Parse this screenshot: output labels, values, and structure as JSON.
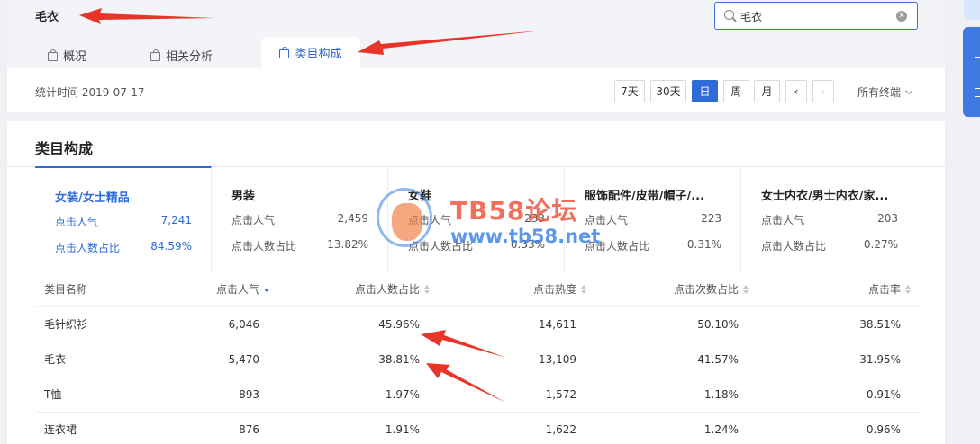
{
  "header": {
    "title": "毛衣",
    "search": {
      "value": "毛衣",
      "placeholder": ""
    },
    "tabs": [
      {
        "label": "概况"
      },
      {
        "label": "相关分析"
      },
      {
        "label": "类目构成",
        "active": true
      }
    ]
  },
  "toolbar": {
    "stat_date_label": "统计时间 2019-07-17",
    "ranges": [
      "7天",
      "30天",
      "日",
      "周",
      "月"
    ],
    "active_range": "日",
    "prev_icon": "‹",
    "next_icon": "›",
    "terminal": "所有终端"
  },
  "category": {
    "title": "类目构成",
    "cards": [
      {
        "name": "女装/女士精品",
        "metric1_label": "点击人气",
        "metric1_value": "7,241",
        "metric2_label": "点击人数占比",
        "metric2_value": "84.59%"
      },
      {
        "name": "男装",
        "metric1_label": "点击人气",
        "metric1_value": "2,459",
        "metric2_label": "点击人数占比",
        "metric2_value": "13.82%"
      },
      {
        "name": "女鞋",
        "metric1_label": "点击人气",
        "metric1_value": "233",
        "metric2_label": "点击人数占比",
        "metric2_value": "0.33%"
      },
      {
        "name": "服饰配件/皮带/帽子/...",
        "metric1_label": "点击人气",
        "metric1_value": "223",
        "metric2_label": "点击人数占比",
        "metric2_value": "0.31%"
      },
      {
        "name": "女士内衣/男士内衣/家...",
        "metric1_label": "点击人气",
        "metric1_value": "203",
        "metric2_label": "点击人数占比",
        "metric2_value": "0.27%"
      }
    ],
    "table": {
      "columns": [
        "类目名称",
        "点击人气",
        "点击人数占比",
        "点击热度",
        "点击次数占比",
        "点击率"
      ],
      "rows": [
        [
          "毛针织衫",
          "6,046",
          "45.96%",
          "14,611",
          "50.10%",
          "38.51%"
        ],
        [
          "毛衣",
          "5,470",
          "38.81%",
          "13,109",
          "41.57%",
          "31.95%"
        ],
        [
          "T恤",
          "893",
          "1.97%",
          "1,572",
          "1.18%",
          "0.91%"
        ],
        [
          "连衣裙",
          "876",
          "1.91%",
          "1,622",
          "1.24%",
          "0.96%"
        ]
      ]
    }
  },
  "watermark": {
    "line1": "TB58论坛",
    "line2": "www.tb58.net"
  },
  "colors": {
    "accent": "#2e6bd6",
    "arrow": "#e8352a"
  }
}
